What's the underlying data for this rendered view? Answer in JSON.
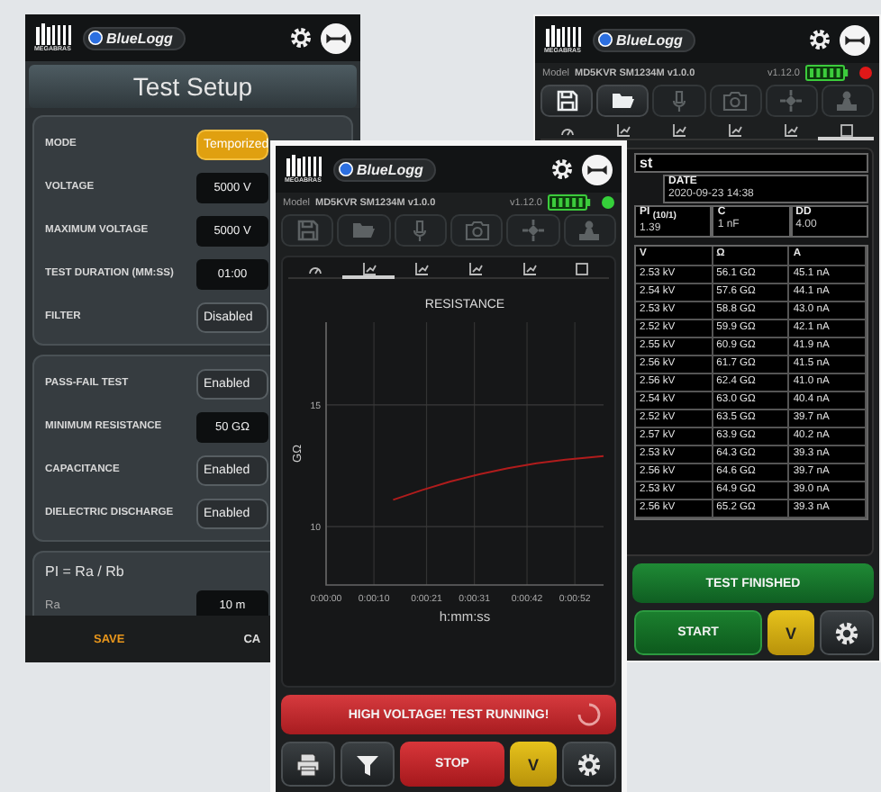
{
  "setup_screen": {
    "brand": "MEGABRAS",
    "app_name": "BlueLogg",
    "title": "Test Setup",
    "groups": [
      {
        "rows": [
          {
            "label": "MODE",
            "value": "Temporized",
            "kind": "select",
            "highlighted": true
          },
          {
            "label": "VOLTAGE",
            "value": "5000 V",
            "kind": "input",
            "highlighted": false
          },
          {
            "label": "MAXIMUM VOLTAGE",
            "value": "5000 V",
            "kind": "input",
            "highlighted": false
          },
          {
            "label": "TEST DURATION (MM:SS)",
            "value": "01:00",
            "kind": "input",
            "highlighted": false
          },
          {
            "label": "FILTER",
            "value": "Disabled",
            "kind": "select",
            "highlighted": false
          }
        ]
      },
      {
        "rows": [
          {
            "label": "PASS-FAIL TEST",
            "value": "Enabled",
            "kind": "select",
            "highlighted": false
          },
          {
            "label": "MINIMUM RESISTANCE",
            "value": "50 GΩ",
            "kind": "input",
            "highlighted": false
          },
          {
            "label": "CAPACITANCE",
            "value": "Enabled",
            "kind": "select",
            "highlighted": false
          },
          {
            "label": "DIELECTRIC DISCHARGE",
            "value": "Enabled",
            "kind": "select",
            "highlighted": false
          }
        ]
      },
      {
        "heading": "PI = Ra / Rb",
        "rows": [
          {
            "label": "Ra",
            "value": "10 m",
            "kind": "input",
            "highlighted": false
          }
        ]
      }
    ],
    "footer": [
      {
        "label": "SAVE",
        "primary": true
      },
      {
        "label": "CA",
        "primary": false
      }
    ]
  },
  "monitor_screen": {
    "brand": "MEGABRAS",
    "app_name": "BlueLogg",
    "model_label": "Model",
    "model": "MD5KVR SM1234M v1.0.0",
    "firmware": "v1.12.0",
    "status_led": {
      "color": "#35d03a"
    },
    "toolbar": [
      {
        "disabled": true
      },
      {
        "disabled": true
      },
      {
        "disabled": true
      },
      {
        "disabled": true
      },
      {
        "disabled": true
      },
      {
        "disabled": true
      }
    ],
    "chart_tabs": [
      {
        "selected": false
      },
      {
        "selected": true
      },
      {
        "selected": false
      },
      {
        "selected": false
      },
      {
        "selected": false
      },
      {
        "selected": false
      }
    ],
    "chart_data": {
      "type": "line",
      "grid": true,
      "title": "RESISTANCE",
      "xlabel": "h:mm:ss",
      "ylabel": "GΩ",
      "x": [
        14,
        20,
        26,
        32,
        38,
        44,
        50,
        58
      ],
      "series": [
        {
          "color": "#b01c1c",
          "values": [
            11.1,
            11.5,
            11.85,
            12.15,
            12.4,
            12.6,
            12.75,
            12.9
          ]
        }
      ],
      "xlim": [
        0,
        58
      ],
      "ylim": [
        7.6,
        18.4
      ],
      "xticks": [
        {
          "value": 0,
          "label": "0:00:00"
        },
        {
          "value": 10,
          "label": "0:00:10"
        },
        {
          "value": 21,
          "label": "0:00:21"
        },
        {
          "value": 31,
          "label": "0:00:31"
        },
        {
          "value": 42,
          "label": "0:00:42"
        },
        {
          "value": 52,
          "label": "0:00:52"
        }
      ],
      "yticks": [
        10,
        15
      ]
    },
    "banner": {
      "text": "HIGH VOLTAGE! TEST RUNNING!",
      "kind": "running",
      "busy": true
    },
    "buttons": [
      {
        "kind": "printer"
      },
      {
        "kind": "filter"
      },
      {
        "kind": "stop",
        "label": "STOP"
      },
      {
        "kind": "range",
        "label": "V"
      },
      {
        "kind": "settings"
      }
    ]
  },
  "results_screen": {
    "brand": "MEGABRAS",
    "app_name": "BlueLogg",
    "model_label": "Model",
    "model": "MD5KVR SM1234M v1.0.0",
    "firmware": "v1.12.0",
    "status_led": {
      "color": "#e01818"
    },
    "toolbar": [
      {
        "disabled": false
      },
      {
        "disabled": false
      },
      {
        "disabled": true
      },
      {
        "disabled": true
      },
      {
        "disabled": true
      },
      {
        "disabled": true
      }
    ],
    "chart_tabs": [
      {
        "selected": false
      },
      {
        "selected": false
      },
      {
        "selected": false
      },
      {
        "selected": false
      },
      {
        "selected": false
      },
      {
        "selected": true
      }
    ],
    "title": "st",
    "info_rows": [
      [
        {
          "label": "DATE",
          "value": "2020-09-23 14:38"
        }
      ],
      [
        {
          "label": "PI $_{(10/1)}$",
          "value": "1.39"
        },
        {
          "label": "C",
          "value": "1 nF"
        },
        {
          "label": "DD",
          "value": "4.00"
        }
      ]
    ],
    "table": {
      "columns": [
        "V",
        "Ω",
        "A"
      ],
      "rows": [
        [
          "2.53 kV",
          "56.1 GΩ",
          "45.1 nA"
        ],
        [
          "2.54 kV",
          "57.6 GΩ",
          "44.1 nA"
        ],
        [
          "2.53 kV",
          "58.8 GΩ",
          "43.0 nA"
        ],
        [
          "2.52 kV",
          "59.9 GΩ",
          "42.1 nA"
        ],
        [
          "2.55 kV",
          "60.9 GΩ",
          "41.9 nA"
        ],
        [
          "2.56 kV",
          "61.7 GΩ",
          "41.5 nA"
        ],
        [
          "2.56 kV",
          "62.4 GΩ",
          "41.0 nA"
        ],
        [
          "2.54 kV",
          "63.0 GΩ",
          "40.4 nA"
        ],
        [
          "2.52 kV",
          "63.5 GΩ",
          "39.7 nA"
        ],
        [
          "2.57 kV",
          "63.9 GΩ",
          "40.2 nA"
        ],
        [
          "2.53 kV",
          "64.3 GΩ",
          "39.3 nA"
        ],
        [
          "2.56 kV",
          "64.6 GΩ",
          "39.7 nA"
        ],
        [
          "2.53 kV",
          "64.9 GΩ",
          "39.0 nA"
        ],
        [
          "2.56 kV",
          "65.2 GΩ",
          "39.3 nA"
        ]
      ]
    },
    "banner": {
      "text": "TEST FINISHED",
      "kind": "finished",
      "busy": false
    },
    "buttons": [
      {
        "kind": "start",
        "label": "START"
      },
      {
        "kind": "range",
        "label": "V"
      },
      {
        "kind": "settings"
      }
    ]
  }
}
